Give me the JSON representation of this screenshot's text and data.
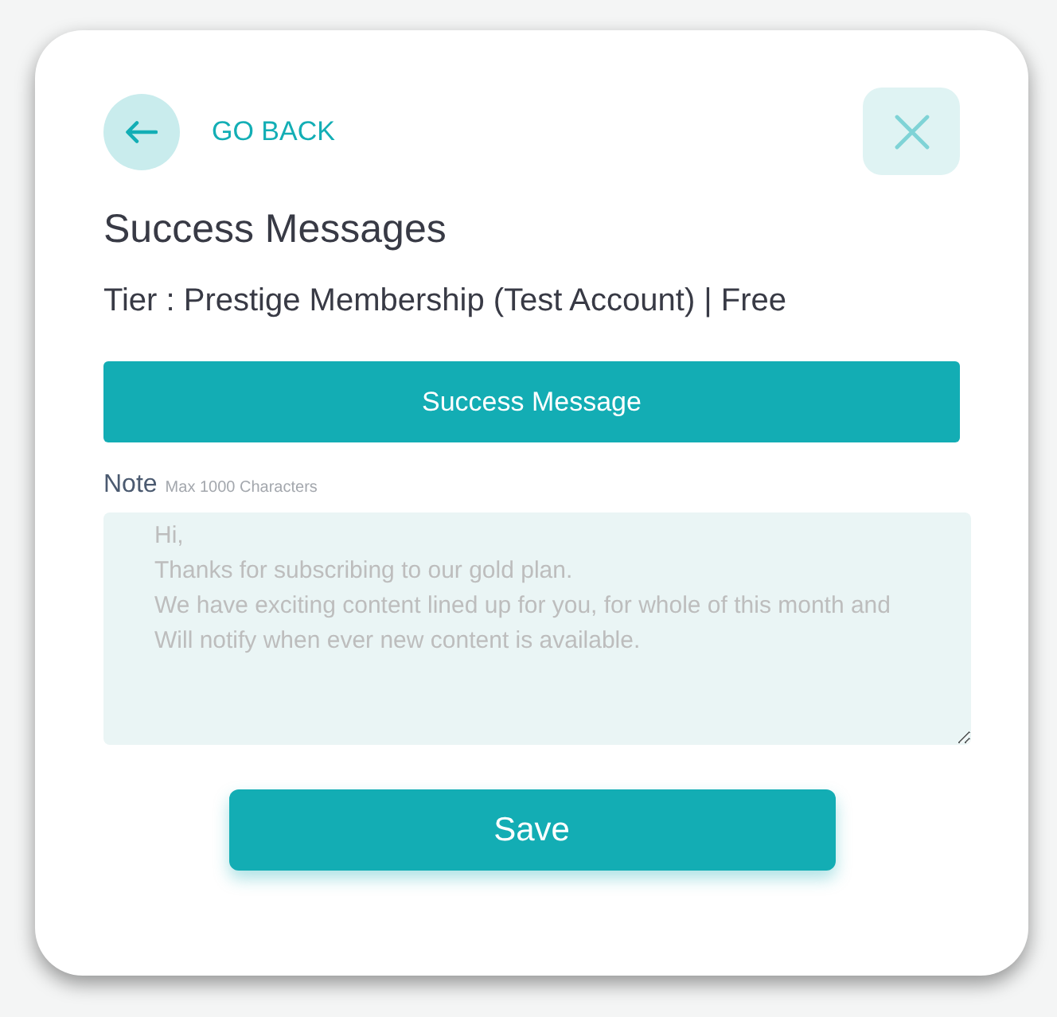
{
  "navigation": {
    "back_label": "GO BACK"
  },
  "modal": {
    "title": "Success Messages",
    "subtitle": "Tier : Prestige Membership (Test Account) | Free"
  },
  "section_header": {
    "label": "Success Message"
  },
  "note": {
    "label": "Note",
    "hint": "Max 1000 Characters",
    "placeholder": "Hi,\nThanks for subscribing to our gold plan.\nWe have exciting content lined up for you, for whole of this month and\nWill notify when ever new content is available."
  },
  "buttons": [
    {
      "label": "Save"
    }
  ]
}
